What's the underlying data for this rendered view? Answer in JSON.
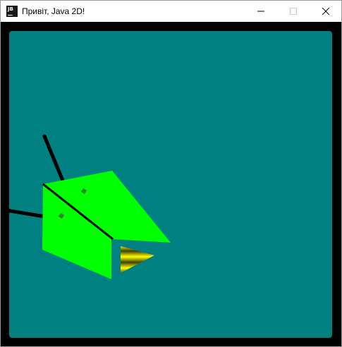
{
  "window": {
    "title": "Привіт, Java 2D!",
    "app_icon_text": "JB",
    "controls": [
      "minimize-icon",
      "maximize-icon",
      "close-icon"
    ]
  },
  "canvas": {
    "background_color": "#008080",
    "frame_color": "#000000",
    "shapes": {
      "body_color": "#00ff00",
      "line_color": "#000000",
      "eye_color": "#2a8a2a",
      "beak_gradient_colors": [
        "#ffff00",
        "#404000"
      ]
    }
  }
}
